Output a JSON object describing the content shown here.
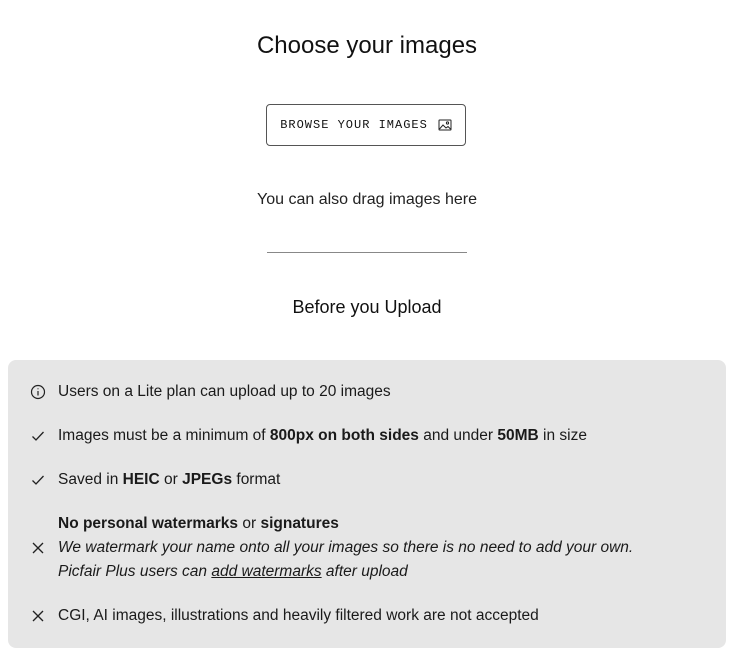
{
  "header": {
    "title": "Choose your images"
  },
  "browse": {
    "label": "BROWSE YOUR IMAGES",
    "icon": "image-icon"
  },
  "drag_text": "You can also drag images here",
  "before_upload": {
    "title": "Before you Upload"
  },
  "rules": [
    {
      "icon": "info-icon",
      "text": "Users on a Lite plan can upload up to 20 images"
    },
    {
      "icon": "check-icon",
      "pre": "Images must be a minimum of ",
      "bold1": "800px on both sides",
      "mid": " and under ",
      "bold2": "50MB",
      "post": " in size"
    },
    {
      "icon": "check-icon",
      "pre": "Saved in ",
      "bold1": "HEIC",
      "mid": " or ",
      "bold2": "JPEGs",
      "post": " format"
    },
    {
      "icon": "close-icon",
      "bold1": "No personal watermarks",
      "mid": " or ",
      "bold2": "signatures",
      "line2": "We watermark your name onto all your images so there is no need to add your own.",
      "line3_pre": "Picfair Plus users can ",
      "line3_link": "add watermarks",
      "line3_post": " after upload"
    },
    {
      "icon": "close-icon",
      "text": "CGI, AI images, illustrations and heavily filtered work are not accepted"
    }
  ]
}
